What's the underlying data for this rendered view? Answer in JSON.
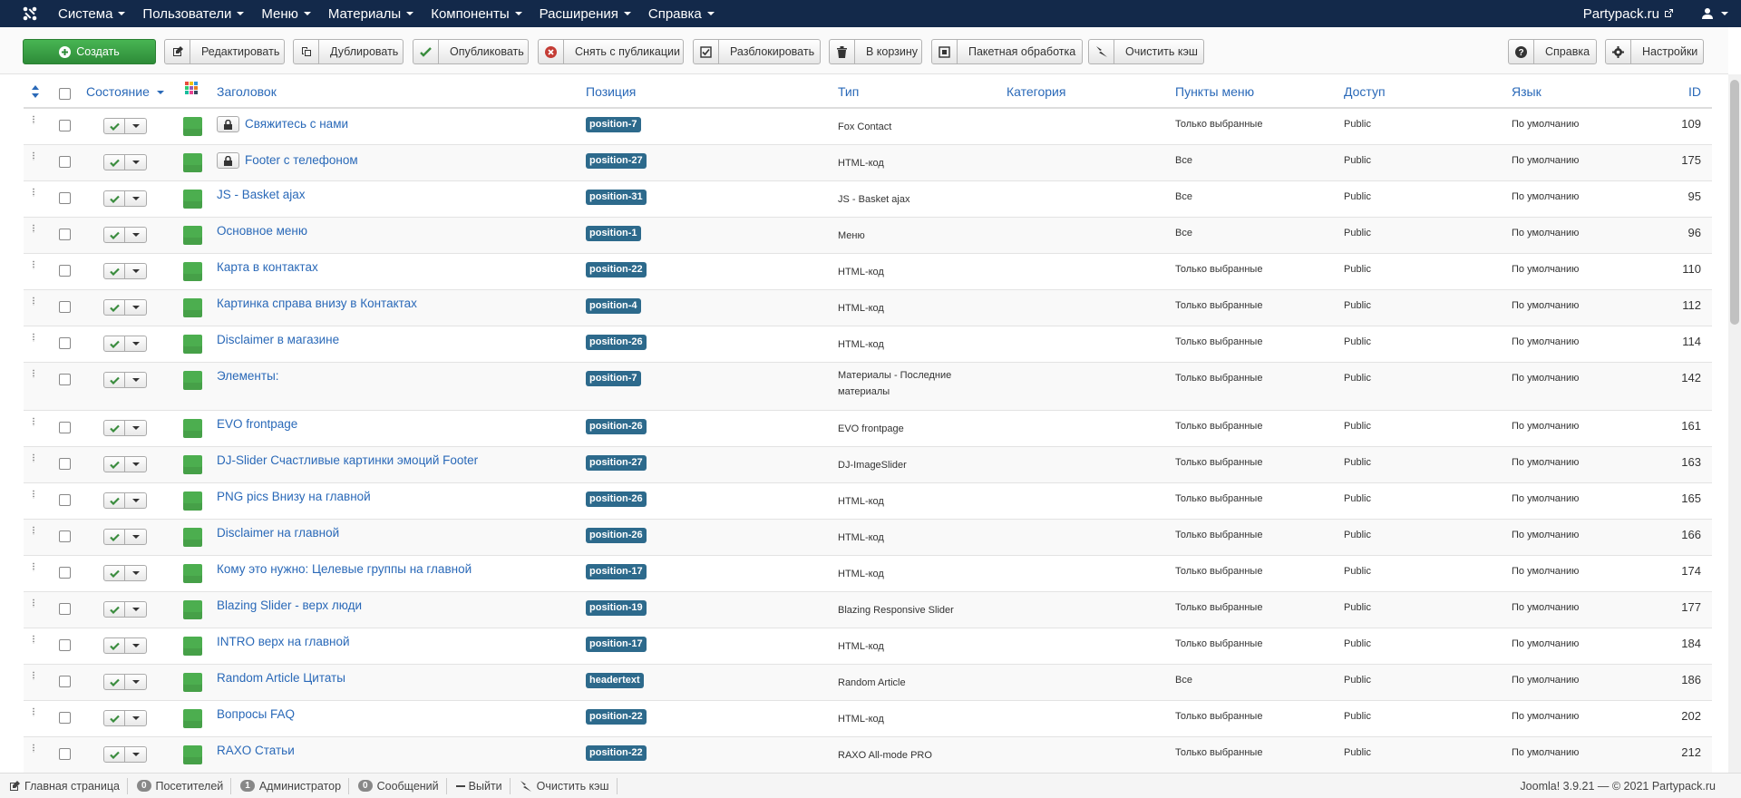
{
  "navbar": {
    "menu": [
      "Система",
      "Пользователи",
      "Меню",
      "Материалы",
      "Компоненты",
      "Расширения",
      "Справка"
    ],
    "site_name": "Partypack.ru"
  },
  "toolbar": {
    "create": "Создать",
    "edit": "Редактировать",
    "duplicate": "Дублировать",
    "publish": "Опубликовать",
    "unpublish": "Снять с публикации",
    "unlock": "Разблокировать",
    "trash": "В корзину",
    "batch": "Пакетная обработка",
    "clear_cache": "Очистить кэш",
    "help": "Справка",
    "options": "Настройки"
  },
  "table": {
    "headers": {
      "state": "Состояние",
      "title": "Заголовок",
      "position": "Позиция",
      "type": "Тип",
      "category": "Категория",
      "menu_points": "Пункты меню",
      "access": "Доступ",
      "language": "Язык",
      "id": "ID"
    },
    "rows": [
      {
        "title": "Свяжитесь с нами",
        "locked": true,
        "position": "position-7",
        "type": "Fox Contact",
        "menu": "Только выбранные",
        "access": "Public",
        "lang": "По умолчанию",
        "id": "109"
      },
      {
        "title": "Footer с телефоном",
        "locked": true,
        "position": "position-27",
        "type": "HTML-код",
        "menu": "Все",
        "access": "Public",
        "lang": "По умолчанию",
        "id": "175"
      },
      {
        "title": "JS - Basket ajax",
        "locked": false,
        "position": "position-31",
        "type": "JS - Basket ajax",
        "menu": "Все",
        "access": "Public",
        "lang": "По умолчанию",
        "id": "95"
      },
      {
        "title": "Основное меню",
        "locked": false,
        "position": "position-1",
        "type": "Меню",
        "menu": "Все",
        "access": "Public",
        "lang": "По умолчанию",
        "id": "96"
      },
      {
        "title": "Карта в контактах",
        "locked": false,
        "position": "position-22",
        "type": "HTML-код",
        "menu": "Только выбранные",
        "access": "Public",
        "lang": "По умолчанию",
        "id": "110"
      },
      {
        "title": "Картинка справа внизу в Контактах",
        "locked": false,
        "position": "position-4",
        "type": "HTML-код",
        "menu": "Только выбранные",
        "access": "Public",
        "lang": "По умолчанию",
        "id": "112"
      },
      {
        "title": "Disclaimer в магазине",
        "locked": false,
        "position": "position-26",
        "type": "HTML-код",
        "menu": "Только выбранные",
        "access": "Public",
        "lang": "По умолчанию",
        "id": "114"
      },
      {
        "title": "Элементы:",
        "locked": false,
        "position": "position-7",
        "type": "Материалы - Последние материалы",
        "menu": "Только выбранные",
        "access": "Public",
        "lang": "По умолчанию",
        "id": "142"
      },
      {
        "title": "EVO frontpage",
        "locked": false,
        "position": "position-26",
        "type": "EVO frontpage",
        "menu": "Только выбранные",
        "access": "Public",
        "lang": "По умолчанию",
        "id": "161"
      },
      {
        "title": "DJ-Slider Счастливые картинки эмоций Footer",
        "locked": false,
        "position": "position-27",
        "type": "DJ-ImageSlider",
        "menu": "Только выбранные",
        "access": "Public",
        "lang": "По умолчанию",
        "id": "163"
      },
      {
        "title": "PNG pics Внизу на главной",
        "locked": false,
        "position": "position-26",
        "type": "HTML-код",
        "menu": "Только выбранные",
        "access": "Public",
        "lang": "По умолчанию",
        "id": "165"
      },
      {
        "title": "Disclaimer на главной",
        "locked": false,
        "position": "position-26",
        "type": "HTML-код",
        "menu": "Только выбранные",
        "access": "Public",
        "lang": "По умолчанию",
        "id": "166"
      },
      {
        "title": "Кому это нужно: Целевые группы на главной",
        "locked": false,
        "position": "position-17",
        "type": "HTML-код",
        "menu": "Только выбранные",
        "access": "Public",
        "lang": "По умолчанию",
        "id": "174"
      },
      {
        "title": "Blazing Slider - верх люди",
        "locked": false,
        "position": "position-19",
        "type": "Blazing Responsive Slider",
        "menu": "Только выбранные",
        "access": "Public",
        "lang": "По умолчанию",
        "id": "177"
      },
      {
        "title": "INTRO верх на главной",
        "locked": false,
        "position": "position-17",
        "type": "HTML-код",
        "menu": "Только выбранные",
        "access": "Public",
        "lang": "По умолчанию",
        "id": "184"
      },
      {
        "title": "Random Article Цитаты",
        "locked": false,
        "position": "headertext",
        "type": "Random Article",
        "menu": "Все",
        "access": "Public",
        "lang": "По умолчанию",
        "id": "186"
      },
      {
        "title": "Вопросы FAQ",
        "locked": false,
        "position": "position-22",
        "type": "HTML-код",
        "menu": "Только выбранные",
        "access": "Public",
        "lang": "По умолчанию",
        "id": "202"
      },
      {
        "title": "RAXO Статьи",
        "locked": false,
        "position": "position-22",
        "type": "RAXO All-mode PRO",
        "menu": "Только выбранные",
        "access": "Public",
        "lang": "По умолчанию",
        "id": "212"
      }
    ]
  },
  "statusbar": {
    "home": "Главная страница",
    "visitors_count": "0",
    "visitors": "Посетителей",
    "admins_count": "1",
    "admins": "Администратор",
    "messages_count": "0",
    "messages": "Сообщений",
    "logout": "Выйти",
    "clear_cache": "Очистить кэш",
    "copyright": "Joomla! 3.9.21 — © 2021 Partypack.ru"
  }
}
